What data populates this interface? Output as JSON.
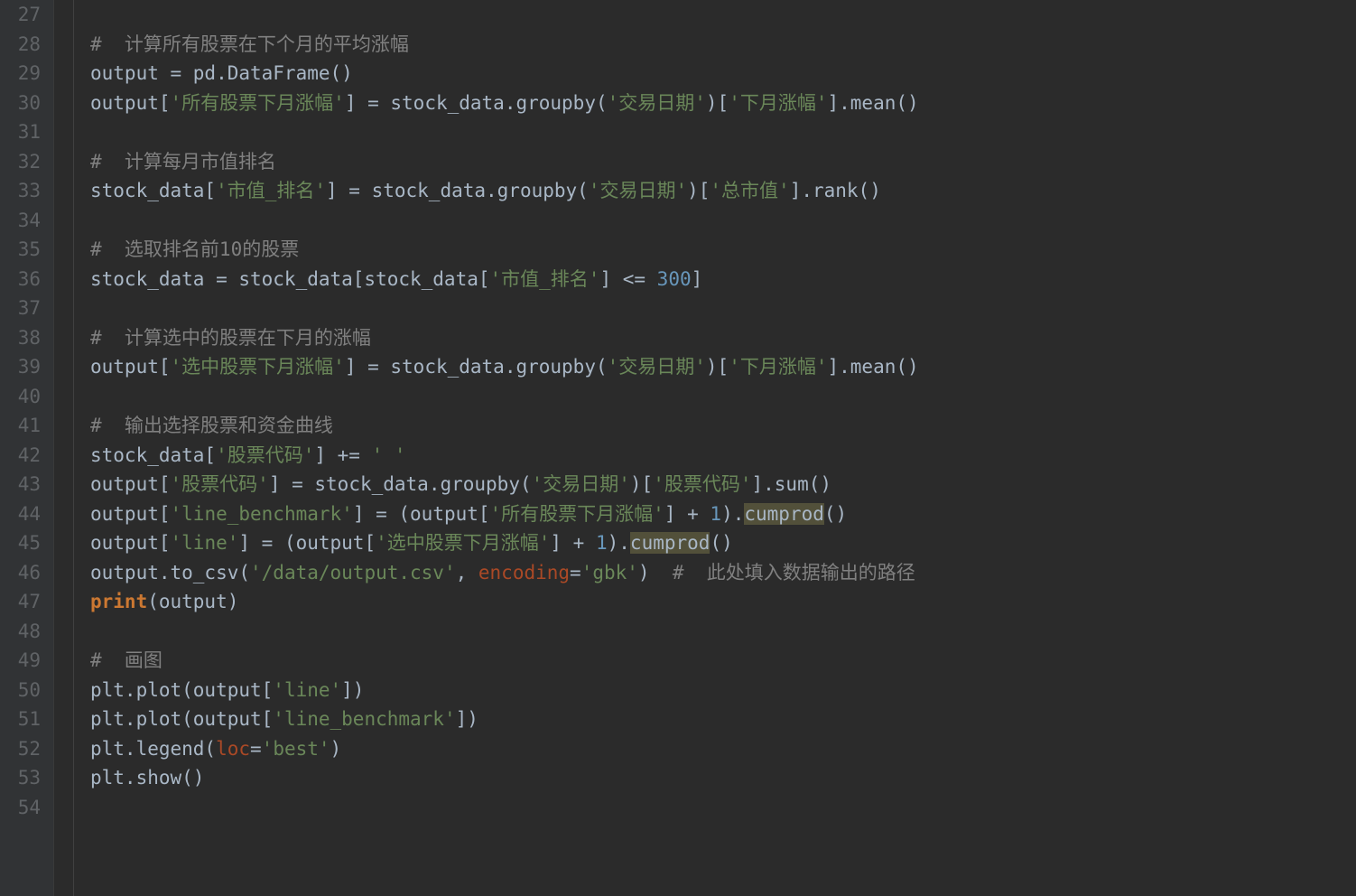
{
  "gutter": {
    "start": 27,
    "end": 54
  },
  "lines": {
    "27": [],
    "28": [
      {
        "t": "comment",
        "v": "#  计算所有股票在下个月的平均涨幅"
      }
    ],
    "29": [
      {
        "t": "default",
        "v": "output = pd.DataFrame()"
      }
    ],
    "30": [
      {
        "t": "default",
        "v": "output["
      },
      {
        "t": "string",
        "v": "'所有股票下月涨幅'"
      },
      {
        "t": "default",
        "v": "] = stock_data.groupby("
      },
      {
        "t": "string",
        "v": "'交易日期'"
      },
      {
        "t": "default",
        "v": ")["
      },
      {
        "t": "string",
        "v": "'下月涨幅'"
      },
      {
        "t": "default",
        "v": "].mean()"
      }
    ],
    "31": [],
    "32": [
      {
        "t": "comment",
        "v": "#  计算每月市值排名"
      }
    ],
    "33": [
      {
        "t": "default",
        "v": "stock_data["
      },
      {
        "t": "string",
        "v": "'市值_排名'"
      },
      {
        "t": "default",
        "v": "] = stock_data.groupby("
      },
      {
        "t": "string",
        "v": "'交易日期'"
      },
      {
        "t": "default",
        "v": ")["
      },
      {
        "t": "string",
        "v": "'总市值'"
      },
      {
        "t": "default",
        "v": "].rank()"
      }
    ],
    "34": [],
    "35": [
      {
        "t": "comment",
        "v": "#  选取排名前10的股票"
      }
    ],
    "36": [
      {
        "t": "default",
        "v": "stock_data = stock_data[stock_data["
      },
      {
        "t": "string",
        "v": "'市值_排名'"
      },
      {
        "t": "default",
        "v": "] <= "
      },
      {
        "t": "number",
        "v": "300"
      },
      {
        "t": "default",
        "v": "]"
      }
    ],
    "37": [],
    "38": [
      {
        "t": "comment",
        "v": "#  计算选中的股票在下月的涨幅"
      }
    ],
    "39": [
      {
        "t": "default",
        "v": "output["
      },
      {
        "t": "string",
        "v": "'选中股票下月涨幅'"
      },
      {
        "t": "default",
        "v": "] = stock_data.groupby("
      },
      {
        "t": "string",
        "v": "'交易日期'"
      },
      {
        "t": "default",
        "v": ")["
      },
      {
        "t": "string",
        "v": "'下月涨幅'"
      },
      {
        "t": "default",
        "v": "].mean()"
      }
    ],
    "40": [],
    "41": [
      {
        "t": "comment",
        "v": "#  输出选择股票和资金曲线"
      }
    ],
    "42": [
      {
        "t": "default",
        "v": "stock_data["
      },
      {
        "t": "string",
        "v": "'股票代码'"
      },
      {
        "t": "default",
        "v": "] += "
      },
      {
        "t": "string",
        "v": "' '"
      }
    ],
    "43": [
      {
        "t": "default",
        "v": "output["
      },
      {
        "t": "string",
        "v": "'股票代码'"
      },
      {
        "t": "default",
        "v": "] = stock_data.groupby("
      },
      {
        "t": "string",
        "v": "'交易日期'"
      },
      {
        "t": "default",
        "v": ")["
      },
      {
        "t": "string",
        "v": "'股票代码'"
      },
      {
        "t": "default",
        "v": "].sum()"
      }
    ],
    "44": [
      {
        "t": "default",
        "v": "output["
      },
      {
        "t": "string",
        "v": "'line_benchmark'"
      },
      {
        "t": "default",
        "v": "] = (output["
      },
      {
        "t": "string",
        "v": "'所有股票下月涨幅'"
      },
      {
        "t": "default",
        "v": "] + "
      },
      {
        "t": "number",
        "v": "1"
      },
      {
        "t": "default",
        "v": ")."
      },
      {
        "t": "highlighted",
        "v": "cumprod"
      },
      {
        "t": "default",
        "v": "()"
      }
    ],
    "45": [
      {
        "t": "default",
        "v": "output["
      },
      {
        "t": "string",
        "v": "'line'"
      },
      {
        "t": "default",
        "v": "] = (output["
      },
      {
        "t": "string",
        "v": "'选中股票下月涨幅'"
      },
      {
        "t": "default",
        "v": "] + "
      },
      {
        "t": "number",
        "v": "1"
      },
      {
        "t": "default",
        "v": ")."
      },
      {
        "t": "highlighted",
        "v": "cumprod"
      },
      {
        "t": "default",
        "v": "()"
      }
    ],
    "46": [
      {
        "t": "default",
        "v": "output.to_csv("
      },
      {
        "t": "string",
        "v": "'/data/output.csv'"
      },
      {
        "t": "default",
        "v": ", "
      },
      {
        "t": "kwarg",
        "v": "encoding"
      },
      {
        "t": "default",
        "v": "="
      },
      {
        "t": "string",
        "v": "'gbk'"
      },
      {
        "t": "default",
        "v": ")  "
      },
      {
        "t": "comment",
        "v": "#  此处填入数据输出的路径"
      }
    ],
    "47": [
      {
        "t": "builtin",
        "v": "print"
      },
      {
        "t": "default",
        "v": "(output)"
      }
    ],
    "48": [],
    "49": [
      {
        "t": "comment",
        "v": "#  画图"
      }
    ],
    "50": [
      {
        "t": "default",
        "v": "plt.plot(output["
      },
      {
        "t": "string",
        "v": "'line'"
      },
      {
        "t": "default",
        "v": "])"
      }
    ],
    "51": [
      {
        "t": "default",
        "v": "plt.plot(output["
      },
      {
        "t": "string",
        "v": "'line_benchmark'"
      },
      {
        "t": "default",
        "v": "])"
      }
    ],
    "52": [
      {
        "t": "default",
        "v": "plt.legend("
      },
      {
        "t": "kwarg",
        "v": "loc"
      },
      {
        "t": "default",
        "v": "="
      },
      {
        "t": "string",
        "v": "'best'"
      },
      {
        "t": "default",
        "v": ")"
      }
    ],
    "53": [
      {
        "t": "default",
        "v": "plt.show()"
      }
    ],
    "54": []
  }
}
